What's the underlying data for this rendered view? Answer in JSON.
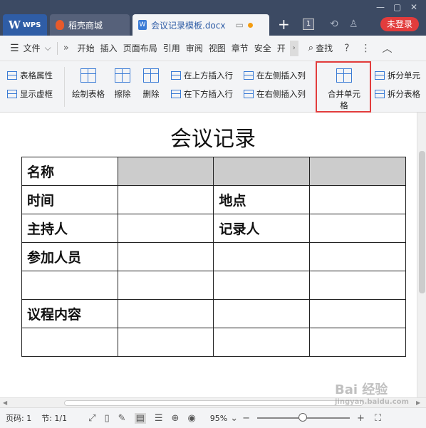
{
  "tabs": [
    {
      "label": "WPS"
    },
    {
      "label": "稻壳商城"
    },
    {
      "label": "会议记录模板.docx"
    }
  ],
  "titlebar": {
    "add_tab": "+",
    "tab_count": "1",
    "login_label": "未登录"
  },
  "menu": {
    "file_label": "文件",
    "items": [
      "开始",
      "插入",
      "页面布局",
      "引用",
      "审阅",
      "视图",
      "章节",
      "安全",
      "开"
    ],
    "search_label": "查找"
  },
  "ribbon": {
    "table_props": "表格属性",
    "show_gridlines": "显示虚框",
    "draw_table": "绘制表格",
    "erase": "擦除",
    "delete": "删除",
    "insert_above": "在上方插入行",
    "insert_below": "在下方插入行",
    "insert_left": "在左侧插入列",
    "insert_right": "在右侧插入列",
    "merge_cells": "合并单元格",
    "split_cells": "拆分单元",
    "split_table": "拆分表格"
  },
  "document": {
    "title": "会议记录",
    "rows": [
      [
        "名称",
        "",
        "",
        ""
      ],
      [
        "时间",
        "",
        "地点",
        ""
      ],
      [
        "主持人",
        "",
        "记录人",
        ""
      ],
      [
        "参加人员",
        "",
        "",
        ""
      ],
      [
        "",
        "",
        "",
        ""
      ],
      [
        "议程内容",
        "",
        "",
        ""
      ],
      [
        "",
        "",
        "",
        ""
      ]
    ]
  },
  "status": {
    "page": "页码: 1",
    "section": "节: 1/1",
    "zoom": "95%"
  },
  "watermark": {
    "main": "Bai 经验",
    "sub": "jingyan.baidu.com"
  },
  "colors": {
    "titlebar_bg": "#3c4a63",
    "accent_blue": "#2f5da6",
    "login_red": "#e23c3c",
    "highlight_box": "#e23c3c",
    "shaded_cell": "#cccccc"
  }
}
